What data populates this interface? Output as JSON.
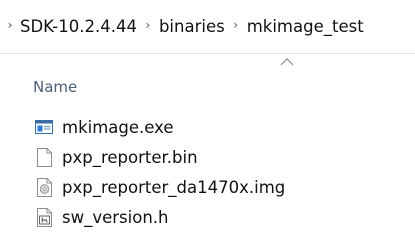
{
  "breadcrumb": {
    "items": [
      "SDK-10.2.4.44",
      "binaries",
      "mkimage_test"
    ],
    "separator": "›"
  },
  "header": {
    "name_column": "Name",
    "sort": "ascending"
  },
  "files": [
    {
      "name": "mkimage.exe",
      "icon": "exe-icon"
    },
    {
      "name": "pxp_reporter.bin",
      "icon": "blank-file-icon"
    },
    {
      "name": "pxp_reporter_da1470x.img",
      "icon": "disc-image-icon"
    },
    {
      "name": "sw_version.h",
      "icon": "header-file-icon"
    }
  ]
}
